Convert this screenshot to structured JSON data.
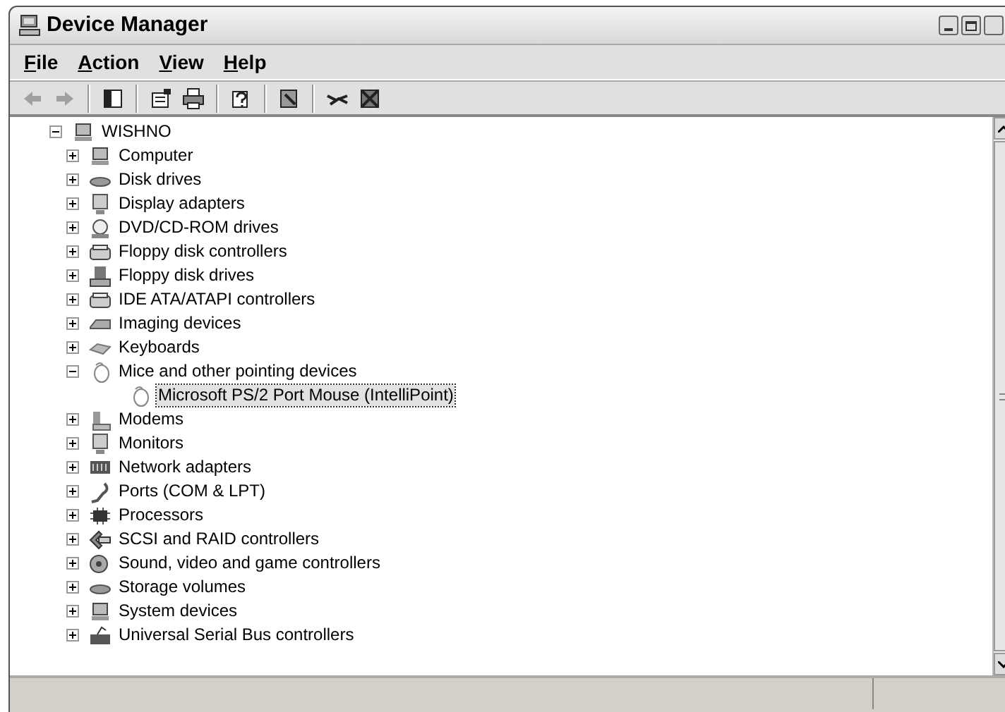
{
  "window": {
    "title": "Device Manager"
  },
  "menu": [
    {
      "label": "File"
    },
    {
      "label": "Action"
    },
    {
      "label": "View"
    },
    {
      "label": "Help"
    }
  ],
  "toolbar": [
    {
      "kind": "back",
      "disabled": true
    },
    {
      "kind": "forward",
      "disabled": true
    },
    {
      "kind": "separator"
    },
    {
      "kind": "tree",
      "disabled": false
    },
    {
      "kind": "separator"
    },
    {
      "kind": "properties",
      "disabled": false
    },
    {
      "kind": "print",
      "disabled": false
    },
    {
      "kind": "separator"
    },
    {
      "kind": "help",
      "disabled": false
    },
    {
      "kind": "separator"
    },
    {
      "kind": "scan",
      "disabled": false
    },
    {
      "kind": "separator"
    },
    {
      "kind": "disable",
      "disabled": false
    },
    {
      "kind": "uninstall",
      "disabled": false
    }
  ],
  "tree": {
    "label": "WISHNO",
    "expanded": true,
    "selected": false,
    "children": [
      {
        "label": "Computer",
        "expanded": false,
        "selected": false
      },
      {
        "label": "Disk drives",
        "expanded": false,
        "selected": false
      },
      {
        "label": "Display adapters",
        "expanded": false,
        "selected": false
      },
      {
        "label": "DVD/CD-ROM drives",
        "expanded": false,
        "selected": false
      },
      {
        "label": "Floppy disk controllers",
        "expanded": false,
        "selected": false
      },
      {
        "label": "Floppy disk drives",
        "expanded": false,
        "selected": false
      },
      {
        "label": "IDE ATA/ATAPI controllers",
        "expanded": false,
        "selected": false
      },
      {
        "label": "Imaging devices",
        "expanded": false,
        "selected": false
      },
      {
        "label": "Keyboards",
        "expanded": false,
        "selected": false
      },
      {
        "label": "Mice and other pointing devices",
        "expanded": true,
        "selected": false,
        "children": [
          {
            "label": "Microsoft PS/2 Port Mouse (IntelliPoint)",
            "selected": true
          }
        ]
      },
      {
        "label": "Modems",
        "expanded": false,
        "selected": false
      },
      {
        "label": "Monitors",
        "expanded": false,
        "selected": false
      },
      {
        "label": "Network adapters",
        "expanded": false,
        "selected": false
      },
      {
        "label": "Ports (COM & LPT)",
        "expanded": false,
        "selected": false
      },
      {
        "label": "Processors",
        "expanded": false,
        "selected": false
      },
      {
        "label": "SCSI and RAID controllers",
        "expanded": false,
        "selected": false
      },
      {
        "label": "Sound, video and game controllers",
        "expanded": false,
        "selected": false
      },
      {
        "label": "Storage volumes",
        "expanded": false,
        "selected": false
      },
      {
        "label": "System devices",
        "expanded": false,
        "selected": false
      },
      {
        "label": "Universal Serial Bus controllers",
        "expanded": false,
        "selected": false
      }
    ]
  }
}
